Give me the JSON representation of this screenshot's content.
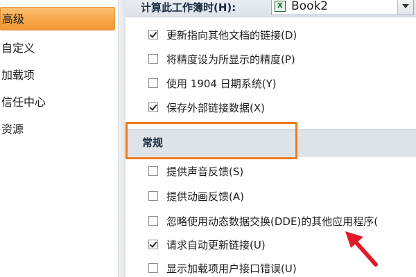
{
  "sidebar": {
    "items": [
      {
        "label": "高级",
        "active": true
      },
      {
        "label": "自定义"
      },
      {
        "label": "加载项"
      },
      {
        "label": "信任中心"
      },
      {
        "label": "资源"
      }
    ]
  },
  "calc": {
    "label": "计算此工作簿时(H):",
    "workbook_value": "Book2"
  },
  "workbook_options": [
    {
      "label": "更新指向其他文档的链接(D)",
      "checked": true
    },
    {
      "label": "将精度设为所显示的精度(P)",
      "checked": false
    },
    {
      "label": "使用 1904 日期系统(Y)",
      "checked": false
    },
    {
      "label": "保存外部链接数据(X)",
      "checked": true
    }
  ],
  "general": {
    "title": "常规",
    "options": [
      {
        "label": "提供声音反馈(S)",
        "checked": false
      },
      {
        "label": "提供动画反馈(A)",
        "checked": false
      },
      {
        "label": "忽略使用动态数据交换(DDE)的其他应用程序(",
        "checked": false
      },
      {
        "label": "请求自动更新链接(U)",
        "checked": true
      },
      {
        "label": "显示加载项用户接口错误(U)",
        "checked": false
      }
    ]
  },
  "colors": {
    "highlight_outline": "#f07a1a",
    "annotation_arrow": "#e0192b",
    "active_nav": "#f7a84a"
  }
}
